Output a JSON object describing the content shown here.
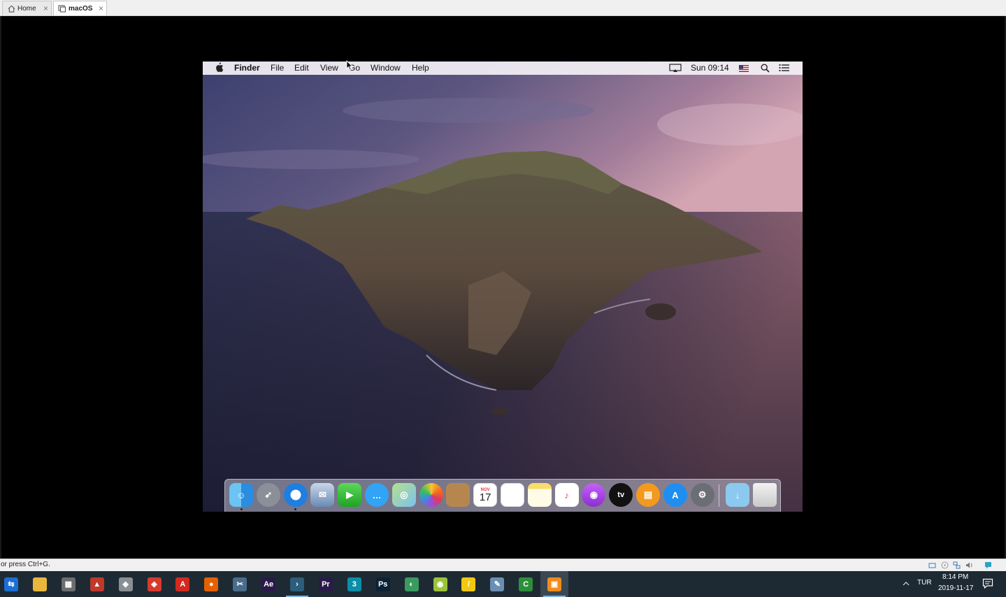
{
  "tabs": [
    {
      "label": "Home",
      "icon": "home-icon",
      "active": false
    },
    {
      "label": "macOS",
      "icon": "vm-icon",
      "active": true
    }
  ],
  "mac": {
    "menubar": {
      "apple_icon": "apple-logo-icon",
      "app_name": "Finder",
      "menus": [
        "File",
        "Edit",
        "View",
        "Go",
        "Window",
        "Help"
      ],
      "clock": "Sun 09:14",
      "status_icons": [
        "airplay-display-icon",
        "us-flag-icon",
        "spotlight-search-icon",
        "notification-center-icon"
      ]
    },
    "wallpaper": "Catalina island at dusk",
    "dock": {
      "apps": [
        {
          "name": "Finder",
          "icon": "finder-icon",
          "running": true
        },
        {
          "name": "Launchpad",
          "icon": "launchpad-rocket-icon",
          "running": false
        },
        {
          "name": "Safari",
          "icon": "safari-compass-icon",
          "running": true
        },
        {
          "name": "Mail",
          "icon": "mail-stamp-icon",
          "running": false
        },
        {
          "name": "FaceTime",
          "icon": "facetime-icon",
          "running": false
        },
        {
          "name": "Messages",
          "icon": "messages-icon",
          "running": false
        },
        {
          "name": "Maps",
          "icon": "maps-icon",
          "running": false
        },
        {
          "name": "Photos",
          "icon": "photos-icon",
          "running": false
        },
        {
          "name": "Contacts",
          "icon": "contacts-icon",
          "running": false
        },
        {
          "name": "Calendar",
          "icon": "calendar-icon",
          "running": false,
          "month": "NOV",
          "day": "17"
        },
        {
          "name": "Reminders",
          "icon": "reminders-icon",
          "running": false
        },
        {
          "name": "Notes",
          "icon": "notes-icon",
          "running": false
        },
        {
          "name": "Music",
          "icon": "music-icon",
          "running": false
        },
        {
          "name": "Podcasts",
          "icon": "podcasts-icon",
          "running": false
        },
        {
          "name": "TV",
          "icon": "apple-tv-icon",
          "running": false,
          "label": "tv"
        },
        {
          "name": "Books",
          "icon": "books-icon",
          "running": false
        },
        {
          "name": "App Store",
          "icon": "app-store-icon",
          "running": false
        },
        {
          "name": "System Preferences",
          "icon": "system-preferences-gear-icon",
          "running": false
        }
      ],
      "right": [
        {
          "name": "Downloads",
          "icon": "downloads-folder-icon"
        },
        {
          "name": "Trash",
          "icon": "trash-icon"
        }
      ]
    }
  },
  "status_bar": {
    "text": "or press Ctrl+G.",
    "icons": [
      "hard-disk-icon",
      "cd-icon",
      "network-icon",
      "sound-icon",
      "message-icon"
    ]
  },
  "taskbar": {
    "apps": [
      {
        "icon": "teamviewer-icon",
        "color": "#1a6fd6",
        "glyph": "⇆"
      },
      {
        "icon": "file-explorer-icon",
        "color": "#e8b73c",
        "glyph": ""
      },
      {
        "icon": "calculator-icon",
        "color": "#6d6d6d",
        "glyph": "▦"
      },
      {
        "icon": "popcorn-icon",
        "color": "#c0392b",
        "glyph": "▲"
      },
      {
        "icon": "network-app-icon",
        "color": "#8a8f94",
        "glyph": "◆"
      },
      {
        "icon": "sketchup-icon",
        "color": "#d73a2d",
        "glyph": "◈"
      },
      {
        "icon": "acrobat-icon",
        "color": "#d22a1f",
        "glyph": "A"
      },
      {
        "icon": "firefox-icon",
        "color": "#e66000",
        "glyph": "●"
      },
      {
        "icon": "snipping-tool-icon",
        "color": "#4a6c8c",
        "glyph": "✂"
      },
      {
        "icon": "after-effects-icon",
        "color": "#2a1a4a",
        "glyph": "Ae"
      },
      {
        "icon": "powershell-icon",
        "color": "#2c5e7a",
        "glyph": "›"
      },
      {
        "icon": "premiere-icon",
        "color": "#2a1a4a",
        "glyph": "Pr"
      },
      {
        "icon": "3dsmax-icon",
        "color": "#0b8ea6",
        "glyph": "3"
      },
      {
        "icon": "photoshop-icon",
        "color": "#0a2236",
        "glyph": "Ps"
      },
      {
        "icon": "android-studio-icon",
        "color": "#3b9a5e",
        "glyph": "◐"
      },
      {
        "icon": "android-icon",
        "color": "#9ac43a",
        "glyph": "◉"
      },
      {
        "icon": "sticky-notes-icon",
        "color": "#f2c811",
        "glyph": "/"
      },
      {
        "icon": "paint-icon",
        "color": "#6a8fb3",
        "glyph": "✎"
      },
      {
        "icon": "camtasia-icon",
        "color": "#2d8f3a",
        "glyph": "C"
      },
      {
        "icon": "vmware-icon",
        "color": "#ef8c1e",
        "glyph": "▣"
      }
    ],
    "active_app_index": 19,
    "underlined_indexes": [
      10,
      19
    ],
    "tray_chevron": "^",
    "language": "TUR",
    "clock_time": "8:14 PM",
    "clock_date": "2019-11-17",
    "notification_icon": "action-center-icon"
  }
}
